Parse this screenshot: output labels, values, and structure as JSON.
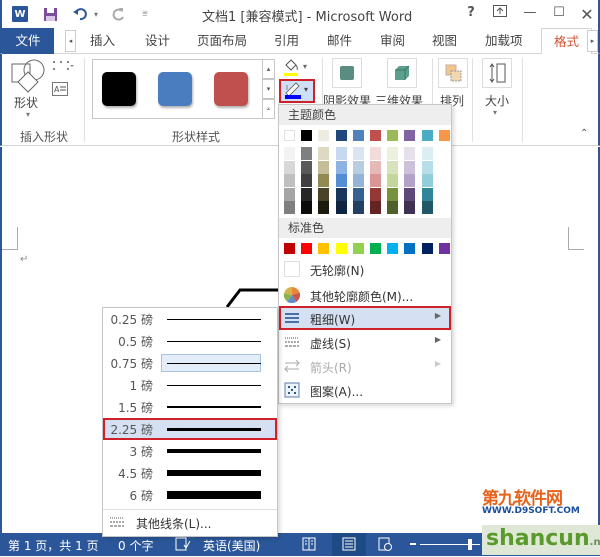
{
  "titlebar": {
    "title": "文档1 [兼容模式] - Microsoft Word",
    "app_icon": "W",
    "help_label": "?",
    "icons": [
      "word-app-icon",
      "save-icon",
      "undo-icon",
      "redo-icon",
      "customize-qat-icon",
      "help-icon",
      "ribbon-display-icon",
      "minimize-icon",
      "maximize-icon",
      "close-icon"
    ]
  },
  "tabs": [
    {
      "label": "文件"
    },
    {
      "label": "插入"
    },
    {
      "label": "设计"
    },
    {
      "label": "页面布局"
    },
    {
      "label": "引用"
    },
    {
      "label": "邮件"
    },
    {
      "label": "审阅"
    },
    {
      "label": "视图"
    },
    {
      "label": "加载项"
    },
    {
      "label": "格式",
      "active": true
    }
  ],
  "ribbon": {
    "insert_shapes": {
      "shape_button": "形状",
      "group_label": "插入形状"
    },
    "shape_styles": {
      "group_label": "形状样式",
      "swatches": [
        {
          "color": "#000000"
        },
        {
          "color": "#4a7dbf"
        },
        {
          "color": "#c0504d"
        }
      ]
    },
    "fill_color_bar": "#ffff00",
    "outline_color_bar": "#0000ff",
    "shadow_effects": "阴影效果",
    "three_d_effects": "三维效果",
    "arrange": "排列",
    "size": "大小"
  },
  "outline_menu": {
    "theme_colors_label": "主题颜色",
    "theme_colors": [
      "#ffffff",
      "#000000",
      "#eeece1",
      "#1f497d",
      "#4f81bd",
      "#c0504d",
      "#9bbb59",
      "#8064a2",
      "#4bacc6",
      "#f79646"
    ],
    "theme_shades": [
      [
        "#f2f2f2",
        "#7f7f7f",
        "#ddd9c3",
        "#c6d9f0",
        "#dbe5f1",
        "#f2dcdb",
        "#ebf1dd",
        "#e5e0ec",
        "#dbeef3"
      ],
      [
        "#d8d8d8",
        "#595959",
        "#c4bd97",
        "#8db3e2",
        "#b8cce4",
        "#e5b9b7",
        "#d7e3bc",
        "#ccc1d9",
        "#b7dde8"
      ],
      [
        "#bfbfbf",
        "#3f3f3f",
        "#938953",
        "#548dd4",
        "#95b3d7",
        "#d99694",
        "#c3d69b",
        "#b2a2c7",
        "#92cddc"
      ],
      [
        "#a5a5a5",
        "#262626",
        "#494429",
        "#17365d",
        "#366092",
        "#953734",
        "#76923c",
        "#5f497a",
        "#31859b"
      ],
      [
        "#7f7f7f",
        "#0c0c0c",
        "#1d1b10",
        "#0f243e",
        "#244061",
        "#632423",
        "#4f6128",
        "#3f3151",
        "#205867"
      ]
    ],
    "standard_colors_label": "标准色",
    "standard_colors": [
      "#c00000",
      "#ff0000",
      "#ffc000",
      "#ffff00",
      "#92d050",
      "#00b050",
      "#00b0f0",
      "#0070c0",
      "#002060",
      "#7030a0"
    ],
    "items": [
      {
        "label": "无轮廓(N)",
        "icon": "no-outline-icon"
      },
      {
        "label": "其他轮廓颜色(M)...",
        "icon": "color-wheel-icon"
      },
      {
        "label": "粗细(W)",
        "icon": "weight-icon",
        "submenu": true,
        "highlighted": true
      },
      {
        "label": "虚线(S)",
        "icon": "dashes-icon",
        "submenu": true
      },
      {
        "label": "箭头(R)",
        "icon": "arrows-icon",
        "submenu": true,
        "disabled": true
      },
      {
        "label": "图案(A)...",
        "icon": "pattern-icon"
      }
    ]
  },
  "weight_menu": {
    "items": [
      {
        "label": "0.25 磅",
        "pt": 0.25
      },
      {
        "label": "0.5 磅",
        "pt": 0.5
      },
      {
        "label": "0.75 磅",
        "pt": 0.75,
        "current": true
      },
      {
        "label": "1 磅",
        "pt": 1
      },
      {
        "label": "1.5 磅",
        "pt": 1.5
      },
      {
        "label": "2.25 磅",
        "pt": 2.25,
        "highlighted": true
      },
      {
        "label": "3 磅",
        "pt": 3
      },
      {
        "label": "4.5 磅",
        "pt": 4.5
      },
      {
        "label": "6 磅",
        "pt": 6
      }
    ],
    "more_lines": "其他线条(L)..."
  },
  "statusbar": {
    "page": "第 1 页，共 1 页",
    "words": "0 个字",
    "language": "英语(美国)"
  },
  "watermark": {
    "site_cn": "第九软件网",
    "site_url": "WWW.D9SOFT.COM",
    "brand": "shancun",
    "brand_suffix": ".net"
  }
}
